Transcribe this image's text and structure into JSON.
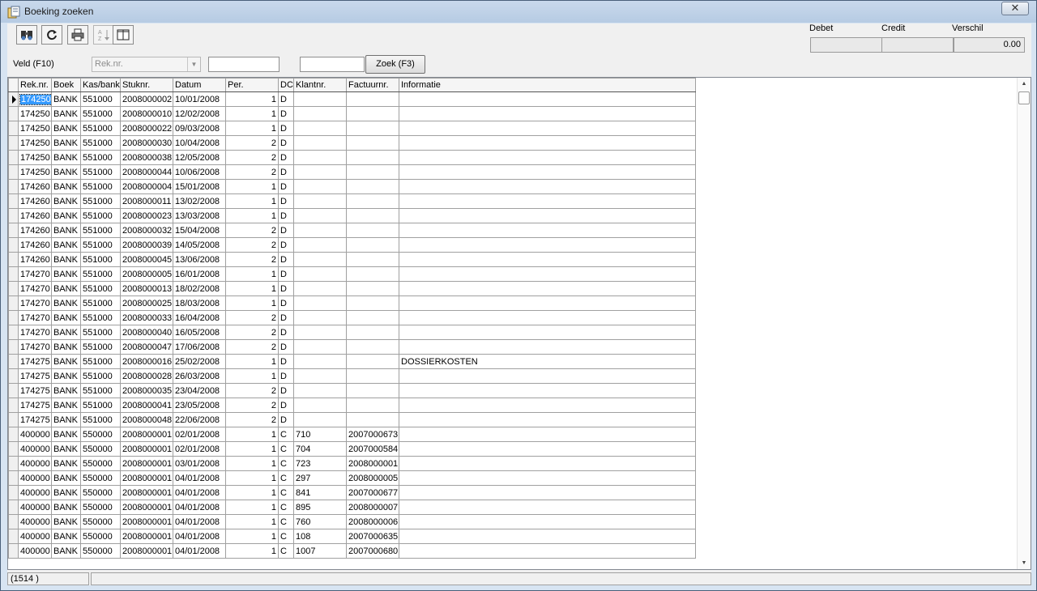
{
  "window": {
    "title": "Boeking zoeken",
    "close_symbol": "✕"
  },
  "toolbar": {
    "buttons": [
      {
        "name": "find-icon",
        "disabled": false
      },
      {
        "name": "refresh-icon",
        "disabled": false
      },
      {
        "name": "print-icon",
        "disabled": false
      },
      {
        "name": "sort-az-icon",
        "disabled": true
      },
      {
        "name": "columns-icon",
        "disabled": false
      }
    ]
  },
  "summary": {
    "debet_label": "Debet",
    "credit_label": "Credit",
    "verschil_label": "Verschil",
    "debet_value": "",
    "credit_value": "",
    "verschil_value": "0.00"
  },
  "search": {
    "field_label": "Veld (F10)",
    "field_selected": "Rek.nr.",
    "value1": "",
    "value2": "",
    "button_label": "Zoek (F3)"
  },
  "grid": {
    "columns": [
      "Rek.nr.",
      "Boek",
      "Kas/bank",
      "Stuknr.",
      "Datum",
      "Per.",
      "DC",
      "Klantnr.",
      "Factuurnr.",
      "Informatie"
    ],
    "rows": [
      [
        "174250",
        "BANK",
        "551000",
        "2008000002",
        "10/01/2008",
        "1",
        "D",
        "",
        "",
        ""
      ],
      [
        "174250",
        "BANK",
        "551000",
        "2008000010",
        "12/02/2008",
        "1",
        "D",
        "",
        "",
        ""
      ],
      [
        "174250",
        "BANK",
        "551000",
        "2008000022",
        "09/03/2008",
        "1",
        "D",
        "",
        "",
        ""
      ],
      [
        "174250",
        "BANK",
        "551000",
        "2008000030",
        "10/04/2008",
        "2",
        "D",
        "",
        "",
        ""
      ],
      [
        "174250",
        "BANK",
        "551000",
        "2008000038",
        "12/05/2008",
        "2",
        "D",
        "",
        "",
        ""
      ],
      [
        "174250",
        "BANK",
        "551000",
        "2008000044",
        "10/06/2008",
        "2",
        "D",
        "",
        "",
        ""
      ],
      [
        "174260",
        "BANK",
        "551000",
        "2008000004",
        "15/01/2008",
        "1",
        "D",
        "",
        "",
        ""
      ],
      [
        "174260",
        "BANK",
        "551000",
        "2008000011",
        "13/02/2008",
        "1",
        "D",
        "",
        "",
        ""
      ],
      [
        "174260",
        "BANK",
        "551000",
        "2008000023",
        "13/03/2008",
        "1",
        "D",
        "",
        "",
        ""
      ],
      [
        "174260",
        "BANK",
        "551000",
        "2008000032",
        "15/04/2008",
        "2",
        "D",
        "",
        "",
        ""
      ],
      [
        "174260",
        "BANK",
        "551000",
        "2008000039",
        "14/05/2008",
        "2",
        "D",
        "",
        "",
        ""
      ],
      [
        "174260",
        "BANK",
        "551000",
        "2008000045",
        "13/06/2008",
        "2",
        "D",
        "",
        "",
        ""
      ],
      [
        "174270",
        "BANK",
        "551000",
        "2008000005",
        "16/01/2008",
        "1",
        "D",
        "",
        "",
        ""
      ],
      [
        "174270",
        "BANK",
        "551000",
        "2008000013",
        "18/02/2008",
        "1",
        "D",
        "",
        "",
        ""
      ],
      [
        "174270",
        "BANK",
        "551000",
        "2008000025",
        "18/03/2008",
        "1",
        "D",
        "",
        "",
        ""
      ],
      [
        "174270",
        "BANK",
        "551000",
        "2008000033",
        "16/04/2008",
        "2",
        "D",
        "",
        "",
        ""
      ],
      [
        "174270",
        "BANK",
        "551000",
        "2008000040",
        "16/05/2008",
        "2",
        "D",
        "",
        "",
        ""
      ],
      [
        "174270",
        "BANK",
        "551000",
        "2008000047",
        "17/06/2008",
        "2",
        "D",
        "",
        "",
        ""
      ],
      [
        "174275",
        "BANK",
        "551000",
        "2008000016",
        "25/02/2008",
        "1",
        "D",
        "",
        "",
        "DOSSIERKOSTEN"
      ],
      [
        "174275",
        "BANK",
        "551000",
        "2008000028",
        "26/03/2008",
        "1",
        "D",
        "",
        "",
        ""
      ],
      [
        "174275",
        "BANK",
        "551000",
        "2008000035",
        "23/04/2008",
        "2",
        "D",
        "",
        "",
        ""
      ],
      [
        "174275",
        "BANK",
        "551000",
        "2008000041",
        "23/05/2008",
        "2",
        "D",
        "",
        "",
        ""
      ],
      [
        "174275",
        "BANK",
        "551000",
        "2008000048",
        "22/06/2008",
        "2",
        "D",
        "",
        "",
        ""
      ],
      [
        "400000",
        "BANK",
        "550000",
        "2008000001",
        "02/01/2008",
        "1",
        "C",
        "710",
        "2007000673",
        ""
      ],
      [
        "400000",
        "BANK",
        "550000",
        "2008000001",
        "02/01/2008",
        "1",
        "C",
        "704",
        "2007000584",
        ""
      ],
      [
        "400000",
        "BANK",
        "550000",
        "2008000001",
        "03/01/2008",
        "1",
        "C",
        "723",
        "2008000001",
        ""
      ],
      [
        "400000",
        "BANK",
        "550000",
        "2008000001",
        "04/01/2008",
        "1",
        "C",
        "297",
        "2008000005",
        ""
      ],
      [
        "400000",
        "BANK",
        "550000",
        "2008000001",
        "04/01/2008",
        "1",
        "C",
        "841",
        "2007000677",
        ""
      ],
      [
        "400000",
        "BANK",
        "550000",
        "2008000001",
        "04/01/2008",
        "1",
        "C",
        "895",
        "2008000007",
        ""
      ],
      [
        "400000",
        "BANK",
        "550000",
        "2008000001",
        "04/01/2008",
        "1",
        "C",
        "760",
        "2008000006",
        ""
      ],
      [
        "400000",
        "BANK",
        "550000",
        "2008000001",
        "04/01/2008",
        "1",
        "C",
        "108",
        "2007000635",
        ""
      ],
      [
        "400000",
        "BANK",
        "550000",
        "2008000001",
        "04/01/2008",
        "1",
        "C",
        "1007",
        "2007000680",
        ""
      ]
    ]
  },
  "status": {
    "count": "(1514 )"
  }
}
